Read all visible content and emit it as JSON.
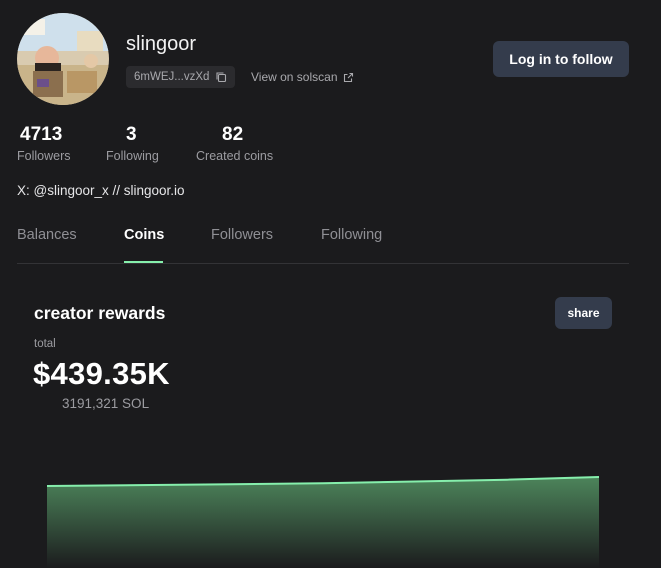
{
  "profile": {
    "username": "slingoor",
    "address_short": "6mWEJ...vzXd",
    "solscan_label": "View on solscan",
    "follow_label": "Log in to follow",
    "bio": "X: @slingoor_x // slingoor.io"
  },
  "stats": [
    {
      "value": "4713",
      "label": "Followers"
    },
    {
      "value": "3",
      "label": "Following"
    },
    {
      "value": "82",
      "label": "Created coins"
    }
  ],
  "tabs": [
    {
      "label": "Balances",
      "active": false
    },
    {
      "label": "Coins",
      "active": true
    },
    {
      "label": "Followers",
      "active": false
    },
    {
      "label": "Following",
      "active": false
    }
  ],
  "rewards": {
    "title": "creator rewards",
    "share_label": "share",
    "total_label": "total",
    "total_value": "$439.35K",
    "sol_value": "3191,321 SOL"
  },
  "colors": {
    "accent": "#86efac",
    "button_bg": "#343c4c",
    "background": "#1b1b1d"
  },
  "icons": {
    "copy": "copy-icon",
    "external": "external-link-icon"
  },
  "chart_data": {
    "type": "area",
    "values": [
      0.9,
      0.91,
      0.92,
      0.93,
      0.95,
      0.97,
      1.0
    ],
    "color": "#86efac"
  }
}
